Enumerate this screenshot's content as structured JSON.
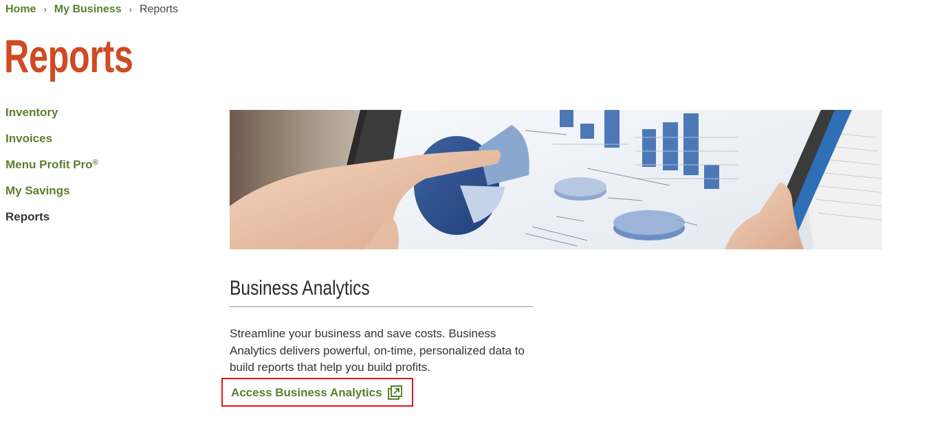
{
  "breadcrumb": {
    "home": "Home",
    "my_business": "My Business",
    "current": "Reports",
    "separator": "›"
  },
  "page_title": "Reports",
  "side_nav": {
    "items": [
      {
        "label": "Inventory",
        "sup": ""
      },
      {
        "label": "Invoices",
        "sup": ""
      },
      {
        "label": "Menu Profit Pro",
        "sup": "®"
      },
      {
        "label": "My Savings",
        "sup": ""
      },
      {
        "label": "Reports",
        "sup": "",
        "active": true
      }
    ]
  },
  "hero": {
    "icon": "tablet-analytics-photo"
  },
  "section": {
    "title": "Business Analytics",
    "description": "Streamline your business and save costs. Business Analytics delivers powerful, on-time, personalized data to build reports that help you build profits.",
    "link_label": "Access Business Analytics",
    "link_icon": "external-link-icon"
  },
  "colors": {
    "brand_green": "#5a7f2e",
    "title_orange": "#d04a22",
    "highlight_red": "#e0161d"
  }
}
